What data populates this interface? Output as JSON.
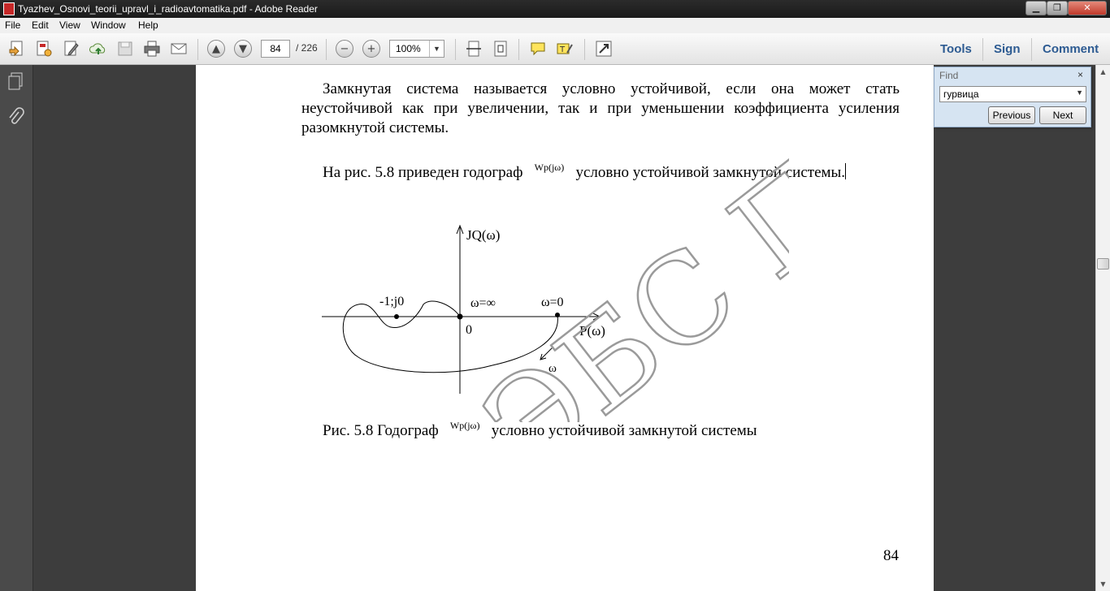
{
  "window": {
    "title": "Tyazhev_Osnovi_teorii_upravl_i_radioavtomatika.pdf - Adobe Reader",
    "minimize_glyph": "▁",
    "maximize_glyph": "❐",
    "close_glyph": "✕"
  },
  "menu": [
    "File",
    "Edit",
    "View",
    "Window",
    "Help"
  ],
  "toolbar": {
    "page_current": "84",
    "page_total": "/ 226",
    "zoom": "100%",
    "right_links": [
      "Tools",
      "Sign",
      "Comment"
    ]
  },
  "find": {
    "label": "Find",
    "close": "×",
    "query": "гурвица",
    "previous": "Previous",
    "next": "Next"
  },
  "document": {
    "paragraph1": "Замкнутая система называется условно устойчивой, если она может стать неустойчивой как при увеличении, так и при уменьшении коэффициента усиления разомкнутой системы.",
    "paragraph2_a": "На рис. 5.8 приведен годограф",
    "formula": "Wр(jω)",
    "paragraph2_b": "условно устойчивой замкнутой системы.",
    "caption_a": "Рис. 5.8  Годограф",
    "caption_b": "условно устойчивой замкнутой системы",
    "page_number": "84",
    "watermark": "ЭБС ПГ"
  },
  "diagram": {
    "y_axis_label": "JQ(ω)",
    "x_axis_label": "P(ω)",
    "origin_label": "0",
    "critical_point_label": "-1;j0",
    "omega_inf_label": "ω=∞",
    "omega_zero_label": "ω=0",
    "direction_label": "ω"
  }
}
